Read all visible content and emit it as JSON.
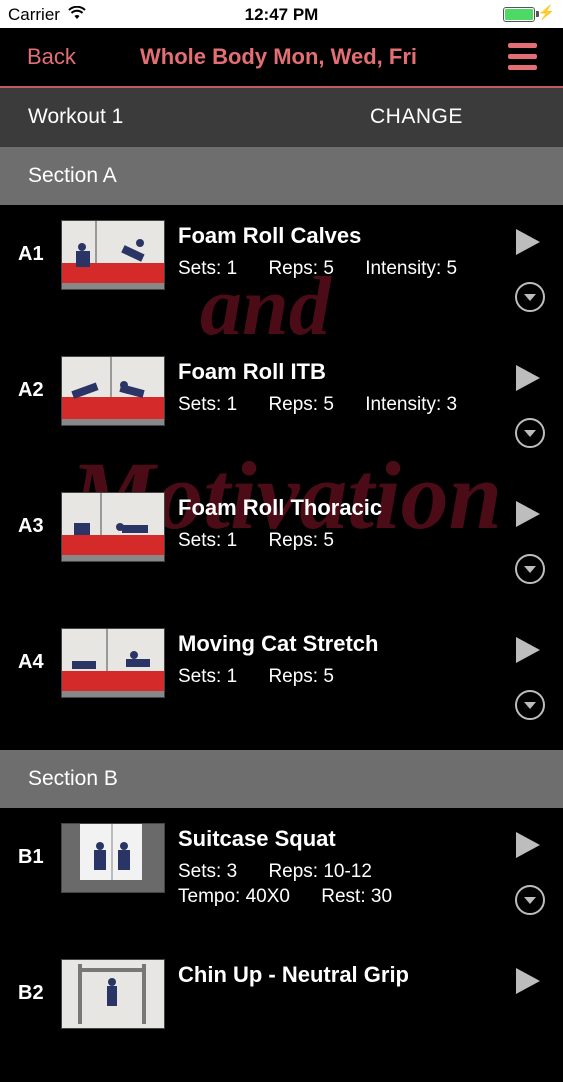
{
  "status_bar": {
    "carrier": "Carrier",
    "time": "12:47 PM"
  },
  "nav": {
    "back_label": "Back",
    "title": "Whole Body Mon, Wed, Fri",
    "menu_icon": "hamburger-menu-icon"
  },
  "workout": {
    "name": "Workout 1",
    "change_label": "CHANGE"
  },
  "watermark": {
    "word1": "and",
    "word2": "Motivation"
  },
  "sections": [
    {
      "title": "Section A",
      "exercises": [
        {
          "code": "A1",
          "name": "Foam Roll Calves",
          "sets": "Sets: 1",
          "reps": "Reps: 5",
          "intensity": "Intensity: 5"
        },
        {
          "code": "A2",
          "name": "Foam Roll ITB",
          "sets": "Sets: 1",
          "reps": "Reps: 5",
          "intensity": "Intensity: 3"
        },
        {
          "code": "A3",
          "name": "Foam Roll Thoracic",
          "sets": "Sets: 1",
          "reps": "Reps: 5"
        },
        {
          "code": "A4",
          "name": "Moving Cat Stretch",
          "sets": "Sets: 1",
          "reps": "Reps: 5"
        }
      ]
    },
    {
      "title": "Section B",
      "exercises": [
        {
          "code": "B1",
          "name": "Suitcase Squat",
          "sets": "Sets: 3",
          "reps": "Reps: 10-12",
          "tempo": "Tempo: 40X0",
          "rest": "Rest: 30"
        },
        {
          "code": "B2",
          "name": "Chin Up - Neutral Grip"
        }
      ]
    }
  ],
  "colors": {
    "accent": "#e36f74",
    "section_bg": "#6e6e6e",
    "workout_bg": "#3b3b3b"
  }
}
